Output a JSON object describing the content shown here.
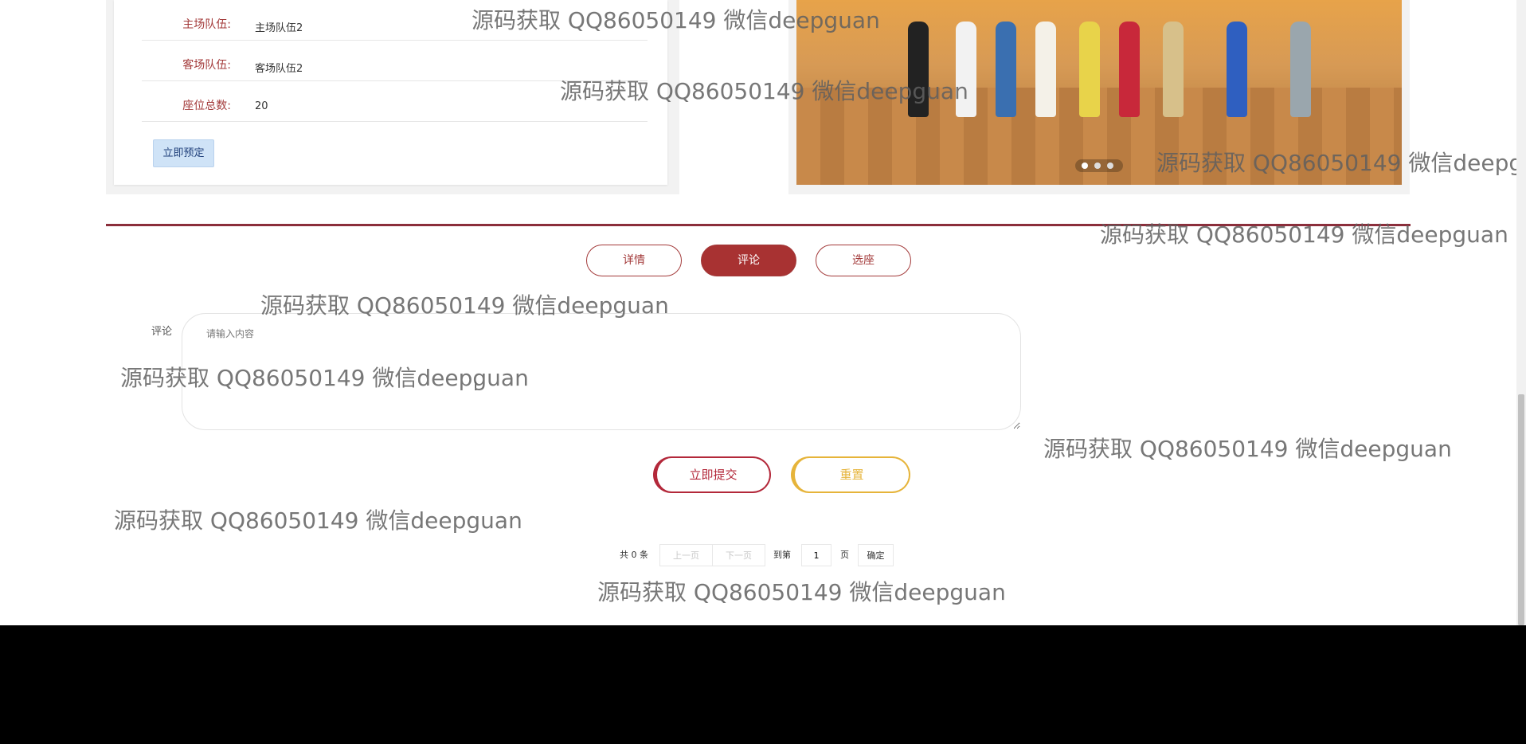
{
  "details": {
    "rows": [
      {
        "label": "主场队伍:",
        "value": "主场队伍2"
      },
      {
        "label": "客场队伍:",
        "value": "客场队伍2"
      },
      {
        "label": "座位总数:",
        "value": "20"
      }
    ],
    "book_button": "立即预定"
  },
  "carousel": {
    "active_index": 0,
    "dot_count": 3
  },
  "tabs": [
    {
      "label": "详情",
      "active": false
    },
    {
      "label": "评论",
      "active": true
    },
    {
      "label": "选座",
      "active": false
    }
  ],
  "comment_form": {
    "label": "评论",
    "placeholder": "请输入内容",
    "value": "",
    "submit_label": "立即提交",
    "reset_label": "重置"
  },
  "pagination": {
    "total_text": "共 0 条",
    "prev_label": "上一页",
    "next_label": "下一页",
    "goto_label": "到第",
    "page_value": "1",
    "page_unit": "页",
    "confirm_label": "确定"
  },
  "watermark": "源码获取 QQ86050149 微信deepguan",
  "colors": {
    "accent": "#a83232",
    "reset": "#e6b43a",
    "divider": "#8b2e3b"
  }
}
